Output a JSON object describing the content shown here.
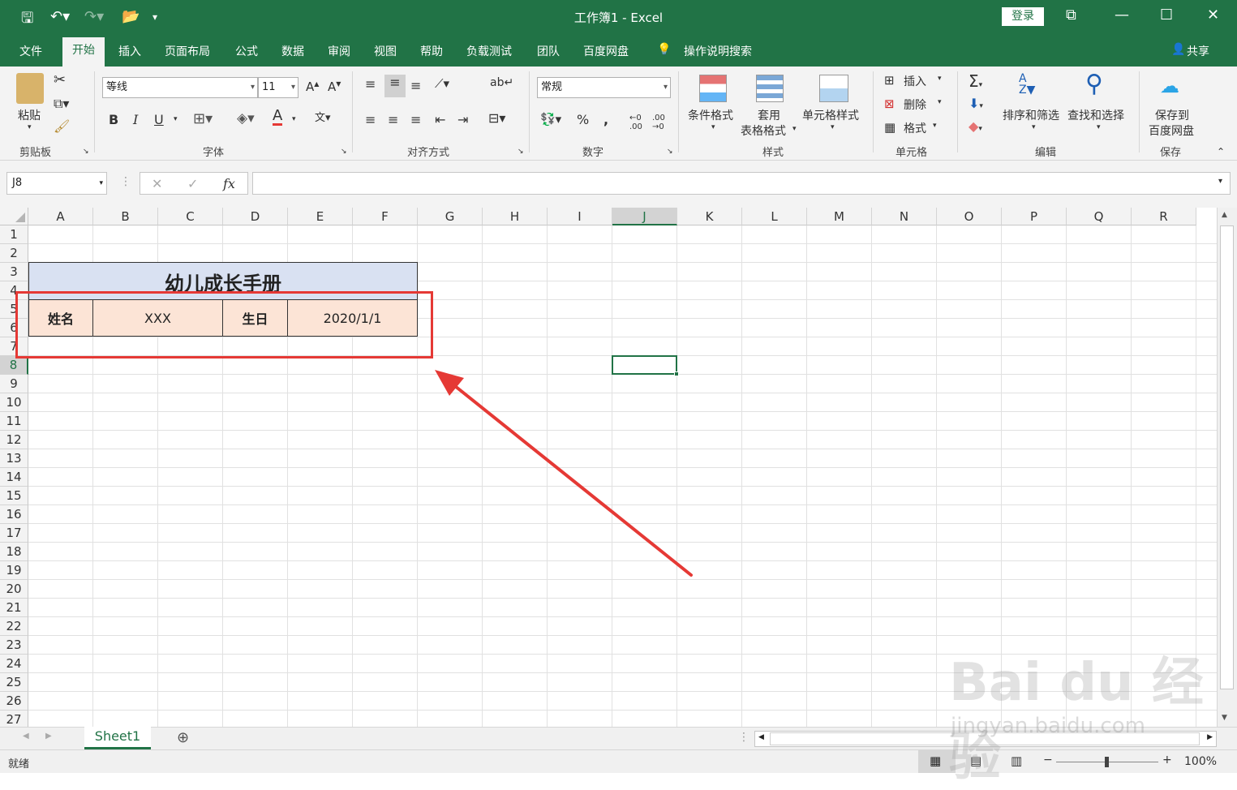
{
  "window": {
    "title": "工作簿1  -  Excel",
    "login": "登录"
  },
  "menu": [
    "文件",
    "开始",
    "插入",
    "页面布局",
    "公式",
    "数据",
    "审阅",
    "视图",
    "帮助",
    "负载测试",
    "团队",
    "百度网盘"
  ],
  "tell_me": "操作说明搜索",
  "share": "共享",
  "ribbon": {
    "paste": "粘贴",
    "font_name": "等线",
    "font_size": "11",
    "bold": "B",
    "italic": "I",
    "underline": "U",
    "number_format": "常规",
    "cond_format": "条件格式",
    "table_format_1": "套用",
    "table_format_2": "表格格式",
    "cell_styles": "单元格样式",
    "insert": "插入",
    "delete": "删除",
    "format": "格式",
    "sort_filter": "排序和筛选",
    "find_select": "查找和选择",
    "save_to_1": "保存到",
    "save_to_2": "百度网盘",
    "groups": [
      "剪贴板",
      "字体",
      "对齐方式",
      "数字",
      "样式",
      "单元格",
      "编辑",
      "保存"
    ]
  },
  "formula_bar": {
    "name_box": "J8",
    "fx": "fx",
    "content": ""
  },
  "columns": [
    "A",
    "B",
    "C",
    "D",
    "E",
    "F",
    "G",
    "H",
    "I",
    "J",
    "K",
    "L",
    "M",
    "N",
    "O",
    "P",
    "Q",
    "R"
  ],
  "rows": [
    "1",
    "2",
    "3",
    "4",
    "5",
    "6",
    "7",
    "8",
    "9",
    "10",
    "11",
    "12",
    "13",
    "14",
    "15",
    "16",
    "17",
    "18",
    "19",
    "20",
    "21",
    "22",
    "23",
    "24",
    "25",
    "26",
    "27"
  ],
  "sheet": {
    "title": "幼儿成长手册",
    "name_label": "姓名",
    "name_value": "XXX",
    "birth_label": "生日",
    "birth_value": "2020/1/1",
    "title_bg": "#d9e1f2",
    "cell_bg": "#fce4d6"
  },
  "tabs": [
    "Sheet1"
  ],
  "status": {
    "ready": "就绪",
    "zoom": "100%"
  },
  "watermark": {
    "brand": "Bai du 经验",
    "url": "jingyan.baidu.com"
  },
  "colors": {
    "accent": "#217346",
    "highlight": "#e53935"
  }
}
